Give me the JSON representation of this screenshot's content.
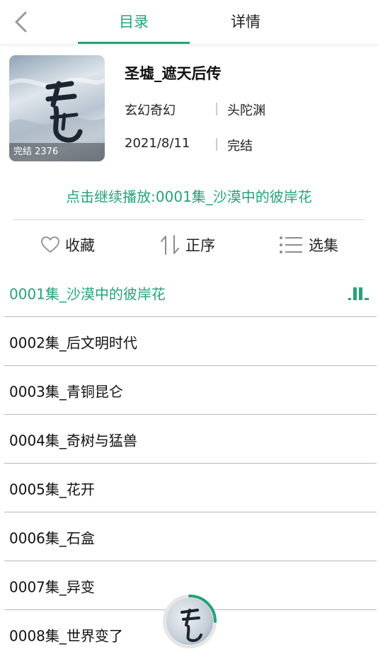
{
  "tabs": {
    "catalog": "目录",
    "details": "详情"
  },
  "book": {
    "title": "圣墟_遮天后传",
    "genre": "玄幻奇幻",
    "author": "头陀渊",
    "date": "2021/8/11",
    "status": "完结",
    "cover_badge": "完结 2376"
  },
  "continue_play": "点击继续播放:0001集_沙漠中的彼岸花",
  "actions": {
    "favorite": "收藏",
    "order": "正序",
    "select": "选集"
  },
  "episodes": [
    "0001集_沙漠中的彼岸花",
    "0002集_后文明时代",
    "0003集_青铜昆仑",
    "0004集_奇树与猛兽",
    "0005集_花开",
    "0006集_石盒",
    "0007集_异变",
    "0008集_世界变了"
  ],
  "colors": {
    "accent": "#26a17b"
  }
}
